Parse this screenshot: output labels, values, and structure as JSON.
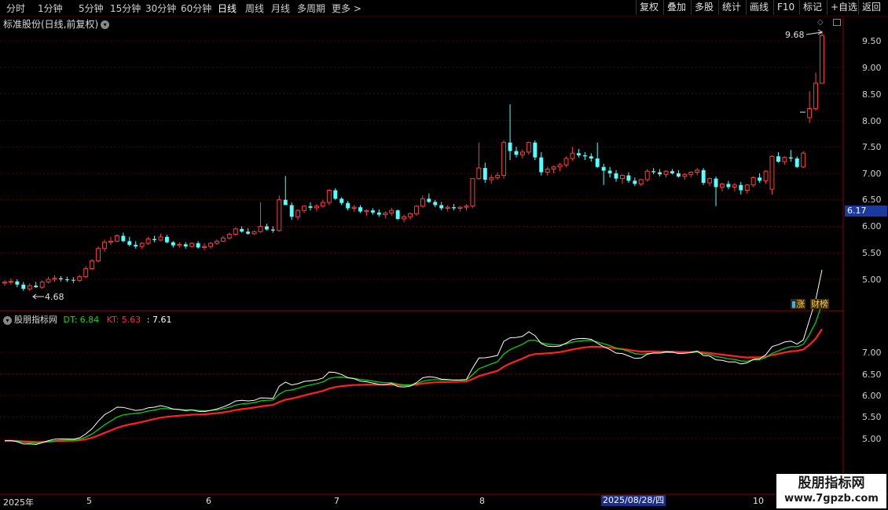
{
  "toolbar": {
    "periods": [
      "分时",
      "1分钟",
      "5分钟",
      "15分钟",
      "30分钟",
      "60分钟",
      "日线",
      "周线",
      "月线",
      "多周期",
      "更多 >"
    ],
    "active_period": "日线",
    "right_buttons": [
      "复权",
      "叠加",
      "多股",
      "统计",
      "画线",
      "F10",
      "标记",
      "+自选",
      "返回"
    ]
  },
  "main": {
    "stock_title": "标准股份(日线,前复权)",
    "high_marker": "9.68",
    "low_marker": "4.68",
    "current_price": "6.17",
    "badges": [
      "涨",
      "财榜"
    ],
    "badge_icons": [
      "flag-icon",
      "flag-icon"
    ],
    "y_ticks": [
      "9.50",
      "9.00",
      "8.50",
      "8.00",
      "7.50",
      "7.00",
      "6.50",
      "6.00",
      "5.50",
      "5.00"
    ]
  },
  "indicator": {
    "name": "股朋指标网",
    "dt_label": "DT: 6.84",
    "kt_label": "KT: 5.63",
    "extra_label": ": 7.61",
    "y_ticks": [
      "7.00",
      "6.50",
      "6.00",
      "5.50",
      "5.00"
    ],
    "colors": {
      "dt": "#00e000",
      "kt": "#ff2020",
      "extra": "#ffffff"
    }
  },
  "xaxis": {
    "labels": [
      "2025年",
      "5",
      "6",
      "7",
      "8",
      "10"
    ],
    "cursor_date": "2025/08/28/四"
  },
  "watermark": {
    "line1": "股朋指标网",
    "line2": "www.7gpzb.com"
  },
  "colors": {
    "up": "#ff3c3c",
    "down": "#54ffff",
    "grid": "#5a0000",
    "axis": "#8b0000"
  },
  "chart_data": {
    "type": "candlestick",
    "ohlc": [
      [
        4.93,
        4.98,
        4.88,
        4.95
      ],
      [
        4.95,
        5.02,
        4.9,
        4.96
      ],
      [
        4.96,
        5.0,
        4.85,
        4.9
      ],
      [
        4.9,
        4.95,
        4.78,
        4.82
      ],
      [
        4.82,
        4.92,
        4.78,
        4.88
      ],
      [
        4.88,
        4.95,
        4.84,
        4.85
      ],
      [
        4.85,
        4.98,
        4.82,
        4.95
      ],
      [
        4.95,
        5.05,
        4.92,
        5.0
      ],
      [
        5.0,
        5.08,
        4.95,
        5.02
      ],
      [
        5.02,
        5.06,
        4.96,
        5.0
      ],
      [
        5.0,
        5.05,
        4.95,
        4.99
      ],
      [
        4.99,
        5.04,
        4.93,
        4.98
      ],
      [
        4.98,
        5.08,
        4.95,
        5.05
      ],
      [
        5.05,
        5.25,
        5.02,
        5.2
      ],
      [
        5.2,
        5.38,
        5.18,
        5.35
      ],
      [
        5.35,
        5.62,
        5.32,
        5.58
      ],
      [
        5.58,
        5.75,
        5.52,
        5.7
      ],
      [
        5.7,
        5.8,
        5.65,
        5.72
      ],
      [
        5.72,
        5.85,
        5.7,
        5.82
      ],
      [
        5.82,
        5.88,
        5.7,
        5.72
      ],
      [
        5.72,
        5.8,
        5.62,
        5.65
      ],
      [
        5.65,
        5.72,
        5.58,
        5.62
      ],
      [
        5.62,
        5.7,
        5.58,
        5.68
      ],
      [
        5.68,
        5.8,
        5.65,
        5.76
      ],
      [
        5.76,
        5.82,
        5.7,
        5.74
      ],
      [
        5.74,
        5.86,
        5.72,
        5.8
      ],
      [
        5.8,
        5.84,
        5.68,
        5.7
      ],
      [
        5.7,
        5.72,
        5.6,
        5.64
      ],
      [
        5.64,
        5.7,
        5.6,
        5.66
      ],
      [
        5.66,
        5.7,
        5.58,
        5.62
      ],
      [
        5.62,
        5.7,
        5.6,
        5.68
      ],
      [
        5.68,
        5.72,
        5.58,
        5.6
      ],
      [
        5.6,
        5.68,
        5.55,
        5.62
      ],
      [
        5.62,
        5.7,
        5.58,
        5.68
      ],
      [
        5.68,
        5.75,
        5.65,
        5.72
      ],
      [
        5.72,
        5.82,
        5.7,
        5.78
      ],
      [
        5.78,
        5.88,
        5.75,
        5.85
      ],
      [
        5.85,
        5.98,
        5.82,
        5.95
      ],
      [
        5.95,
        6.0,
        5.88,
        5.9
      ],
      [
        5.9,
        5.96,
        5.84,
        5.86
      ],
      [
        5.86,
        5.92,
        5.84,
        5.9
      ],
      [
        5.9,
        6.45,
        5.88,
        6.0
      ],
      [
        6.0,
        6.05,
        5.92,
        5.94
      ],
      [
        5.94,
        6.0,
        5.88,
        5.92
      ],
      [
        5.92,
        6.58,
        5.9,
        6.5
      ],
      [
        6.5,
        6.95,
        6.45,
        6.4
      ],
      [
        6.4,
        6.45,
        6.12,
        6.18
      ],
      [
        6.18,
        6.32,
        6.12,
        6.3
      ],
      [
        6.3,
        6.4,
        6.25,
        6.38
      ],
      [
        6.38,
        6.45,
        6.3,
        6.35
      ],
      [
        6.35,
        6.42,
        6.28,
        6.38
      ],
      [
        6.38,
        6.5,
        6.35,
        6.45
      ],
      [
        6.45,
        6.7,
        6.4,
        6.68
      ],
      [
        6.68,
        6.72,
        6.5,
        6.52
      ],
      [
        6.52,
        6.55,
        6.4,
        6.44
      ],
      [
        6.44,
        6.48,
        6.3,
        6.34
      ],
      [
        6.34,
        6.4,
        6.28,
        6.36
      ],
      [
        6.36,
        6.4,
        6.25,
        6.28
      ],
      [
        6.28,
        6.32,
        6.2,
        6.3
      ],
      [
        6.3,
        6.34,
        6.22,
        6.26
      ],
      [
        6.26,
        6.32,
        6.18,
        6.22
      ],
      [
        6.22,
        6.28,
        6.15,
        6.25
      ],
      [
        6.25,
        6.35,
        6.2,
        6.3
      ],
      [
        6.3,
        6.32,
        6.12,
        6.14
      ],
      [
        6.14,
        6.22,
        6.08,
        6.18
      ],
      [
        6.18,
        6.26,
        6.12,
        6.24
      ],
      [
        6.24,
        6.4,
        6.2,
        6.38
      ],
      [
        6.38,
        6.58,
        6.35,
        6.52
      ],
      [
        6.52,
        6.62,
        6.44,
        6.46
      ],
      [
        6.46,
        6.5,
        6.36,
        6.4
      ],
      [
        6.4,
        6.46,
        6.3,
        6.34
      ],
      [
        6.34,
        6.4,
        6.28,
        6.36
      ],
      [
        6.36,
        6.42,
        6.3,
        6.34
      ],
      [
        6.34,
        6.38,
        6.28,
        6.36
      ],
      [
        6.36,
        6.42,
        6.3,
        6.38
      ],
      [
        6.38,
        6.82,
        6.35,
        6.9
      ],
      [
        6.9,
        7.58,
        6.88,
        7.1
      ],
      [
        7.1,
        7.2,
        6.82,
        6.88
      ],
      [
        6.88,
        6.98,
        6.8,
        6.92
      ],
      [
        6.92,
        7.02,
        6.88,
        6.96
      ],
      [
        6.96,
        7.62,
        6.9,
        7.58
      ],
      [
        7.58,
        8.3,
        7.25,
        7.42
      ],
      [
        7.42,
        7.5,
        7.3,
        7.35
      ],
      [
        7.35,
        7.45,
        7.28,
        7.4
      ],
      [
        7.4,
        7.6,
        7.35,
        7.58
      ],
      [
        7.58,
        7.62,
        7.25,
        7.3
      ],
      [
        7.3,
        7.4,
        6.96,
        7.02
      ],
      [
        7.02,
        7.12,
        6.96,
        7.08
      ],
      [
        7.08,
        7.15,
        7.0,
        7.12
      ],
      [
        7.12,
        7.2,
        7.04,
        7.16
      ],
      [
        7.16,
        7.32,
        7.12,
        7.28
      ],
      [
        7.28,
        7.5,
        7.24,
        7.38
      ],
      [
        7.38,
        7.46,
        7.3,
        7.34
      ],
      [
        7.34,
        7.4,
        7.25,
        7.32
      ],
      [
        7.32,
        7.38,
        7.22,
        7.28
      ],
      [
        7.28,
        7.58,
        7.1,
        7.12
      ],
      [
        7.12,
        7.18,
        6.78,
        7.05
      ],
      [
        7.05,
        7.12,
        6.92,
        7.0
      ],
      [
        7.0,
        7.06,
        6.84,
        6.9
      ],
      [
        6.9,
        6.98,
        6.8,
        6.96
      ],
      [
        6.96,
        7.02,
        6.82,
        6.86
      ],
      [
        6.86,
        6.92,
        6.76,
        6.8
      ],
      [
        6.8,
        6.9,
        6.76,
        6.88
      ],
      [
        6.88,
        7.08,
        6.84,
        7.04
      ],
      [
        7.04,
        7.1,
        6.98,
        7.02
      ],
      [
        7.02,
        7.08,
        6.94,
        6.98
      ],
      [
        6.98,
        7.06,
        6.92,
        7.04
      ],
      [
        7.04,
        7.08,
        6.98,
        7.0
      ],
      [
        7.0,
        7.06,
        6.92,
        6.94
      ],
      [
        6.94,
        7.0,
        6.88,
        6.98
      ],
      [
        6.98,
        7.04,
        6.92,
        7.02
      ],
      [
        7.02,
        7.1,
        6.96,
        7.06
      ],
      [
        7.06,
        7.1,
        6.78,
        6.82
      ],
      [
        6.82,
        6.92,
        6.76,
        6.9
      ],
      [
        6.9,
        6.94,
        6.38,
        6.74
      ],
      [
        6.74,
        6.82,
        6.66,
        6.8
      ],
      [
        6.8,
        6.86,
        6.7,
        6.74
      ],
      [
        6.74,
        6.82,
        6.66,
        6.78
      ],
      [
        6.78,
        6.84,
        6.6,
        6.68
      ],
      [
        6.68,
        6.8,
        6.62,
        6.78
      ],
      [
        6.78,
        6.94,
        6.74,
        6.92
      ],
      [
        6.92,
        7.0,
        6.82,
        6.86
      ],
      [
        6.86,
        7.06,
        6.8,
        7.04
      ],
      [
        6.7,
        7.34,
        6.6,
        7.32
      ],
      [
        7.32,
        7.4,
        7.2,
        7.22
      ],
      [
        7.22,
        7.32,
        7.16,
        7.3
      ],
      [
        7.3,
        7.44,
        7.22,
        7.28
      ],
      [
        7.28,
        7.32,
        7.1,
        7.12
      ],
      [
        7.12,
        7.42,
        7.1,
        7.38
      ],
      [
        8.05,
        8.55,
        7.95,
        8.22
      ],
      [
        8.22,
        8.9,
        8.18,
        8.7
      ],
      [
        8.7,
        9.68,
        8.7,
        9.6
      ]
    ],
    "y_range": [
      4.65,
      9.7
    ],
    "x_labels": [
      "2025年",
      "5",
      "6",
      "7",
      "8",
      "10"
    ]
  }
}
